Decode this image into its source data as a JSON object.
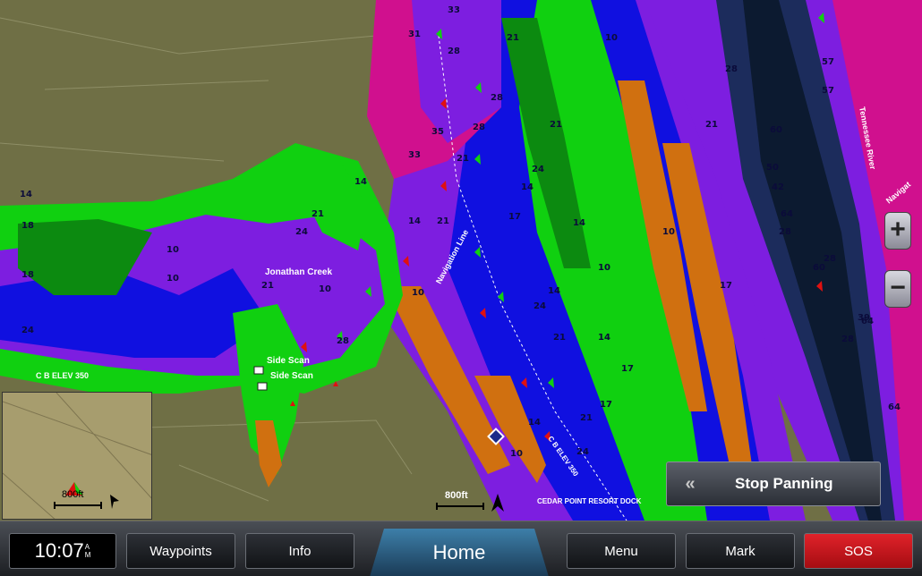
{
  "map": {
    "place_labels": [
      {
        "id": "jonathan-creek",
        "text": "Jonathan Creek"
      },
      {
        "id": "side-scan-1",
        "text": "Side Scan"
      },
      {
        "id": "side-scan-2",
        "text": "Side Scan"
      },
      {
        "id": "navigation-line",
        "text": "Navigation Line"
      },
      {
        "id": "cedar-point",
        "text": "CEDAR POINT RESORT DOCK"
      },
      {
        "id": "elev-left",
        "text": "C B ELEV 350"
      },
      {
        "id": "elev-center",
        "text": "C B ELEV 350"
      },
      {
        "id": "tennessee-river",
        "text": "Tennessee River"
      },
      {
        "id": "navigation-right",
        "text": "Navigat"
      }
    ],
    "depth_labels": [
      "33",
      "31",
      "28",
      "21",
      "10",
      "35",
      "33",
      "28",
      "21",
      "14",
      "21",
      "17",
      "14",
      "24",
      "21",
      "14",
      "28",
      "24",
      "14",
      "10",
      "18",
      "24",
      "10",
      "28",
      "10",
      "14",
      "21",
      "24",
      "21",
      "17",
      "14",
      "21",
      "14",
      "10",
      "28",
      "60",
      "28",
      "42",
      "57",
      "28",
      "64",
      "60",
      "28",
      "64",
      "64",
      "39",
      "57",
      "50",
      "24",
      "10",
      "18",
      "14",
      "10",
      "17",
      "21",
      "21",
      "10",
      "17",
      "14"
    ],
    "scale_main": "800ft",
    "scale_inset": "800ft",
    "colors": {
      "land": "#6f6f45",
      "water_purple": "#7d1ee0",
      "water_blue": "#1010e0",
      "green": "#10d010",
      "orange": "#d07010",
      "magenta": "#d0108e",
      "navy": "#0c2a4a"
    }
  },
  "controls": {
    "zoom_in": "+",
    "zoom_out": "−",
    "stop_panning": "Stop Panning"
  },
  "bottombar": {
    "time": "10:07",
    "am": "A",
    "pm": "M",
    "waypoints": "Waypoints",
    "info": "Info",
    "home": "Home",
    "menu": "Menu",
    "mark": "Mark",
    "sos": "SOS"
  }
}
